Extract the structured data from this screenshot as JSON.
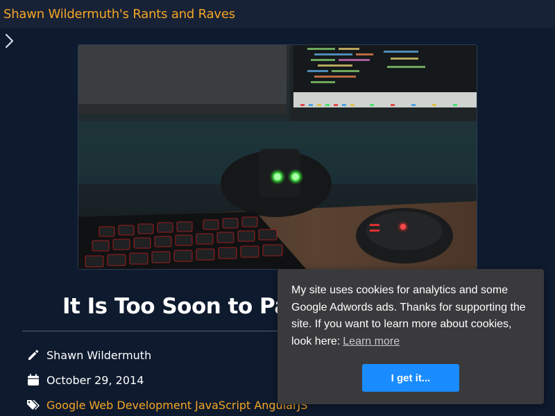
{
  "header": {
    "site_title": "Shawn Wildermuth's Rants and Raves",
    "nav_icon": "chevron-right-icon"
  },
  "hero": {
    "image": "photo-keyboard-mouse-monitor"
  },
  "post": {
    "title": "It Is Too Soon to Par",
    "author": "Shawn Wildermuth",
    "date": "October 29, 2014",
    "tags": [
      "Google",
      "Web Development",
      "JavaScript",
      "AngularJS"
    ]
  },
  "cookie_banner": {
    "message": "My site uses cookies for analytics and some Google Adwords ads. Thanks for supporting the site. If you want to learn more about cookies, look here:",
    "learn_more": "Learn more",
    "accept_label": "I get it..."
  },
  "colors": {
    "accent": "#f5a623",
    "background": "#0e1a2e",
    "topbar": "#182237",
    "cookie_bg": "#3a3a3d",
    "cookie_button": "#1a8cff"
  }
}
